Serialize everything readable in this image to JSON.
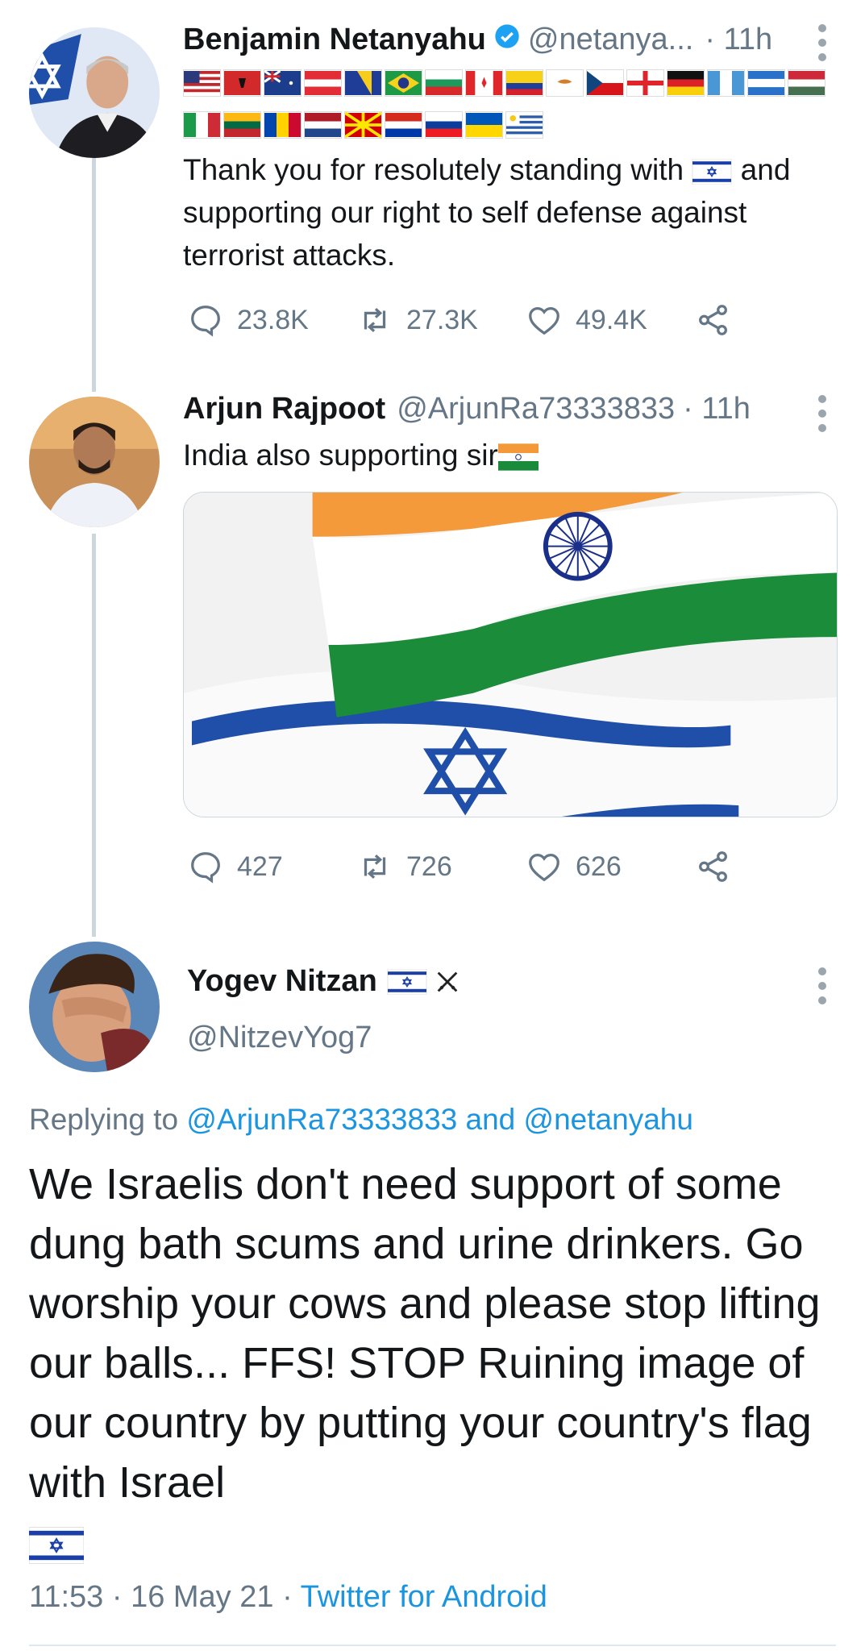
{
  "tweets": [
    {
      "name": "Benjamin Netanyahu",
      "verified": true,
      "handle": "@netanya...",
      "time": "· 11h",
      "text": "Thank you for resolutely standing with",
      "text_after_flag": "and supporting our right to self defense against terrorist attacks.",
      "replies": "23.8K",
      "retweets": "27.3K",
      "likes": "49.4K"
    },
    {
      "name": "Arjun Rajpoot",
      "handle": "@ArjunRa73333833",
      "time": "· 11h",
      "text": "India also supporting sir",
      "replies": "427",
      "retweets": "726",
      "likes": "626"
    }
  ],
  "main_tweet": {
    "name": "Yogev Nitzan",
    "handle": "@NitzevYog7",
    "replying_prefix": "Replying to",
    "reply_user_1": "@ArjunRa73333833",
    "reply_and": "and",
    "reply_user_2": "@netanyahu",
    "text": "We Israelis don't need support of some dung bath scums and urine drinkers. Go worship your cows and please stop lifting our balls... FFS! STOP Ruining image of our country by putting your country's flag with Israel",
    "time": "11:53",
    "date": "16 May 21",
    "separator": "·",
    "source": "Twitter for Android"
  },
  "colors": {
    "link": "#1b95e0",
    "muted": "#657786",
    "verified": "#1da1f2",
    "thread_line": "#ccd6dd"
  },
  "icons": [
    "reply-icon",
    "retweet-icon",
    "like-icon",
    "share-icon",
    "verified-badge-icon",
    "more-options-icon",
    "crossed-swords-icon"
  ]
}
